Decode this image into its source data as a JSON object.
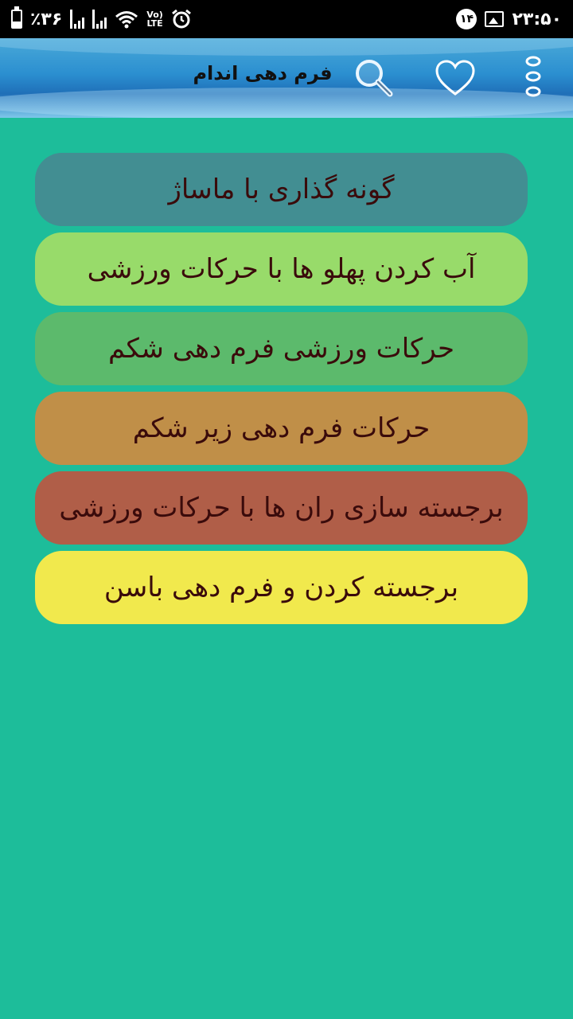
{
  "status_bar": {
    "battery_text": "٪۳۶",
    "battery_level": 0.36,
    "network_label_top": "Vo)",
    "network_label_bottom": "LTE",
    "notification_count": "۱۴",
    "time": "۲۳:۵۰"
  },
  "app_bar": {
    "title": "فرم دهی اندام",
    "icons": [
      "search-icon",
      "heart-icon",
      "more-options-icon"
    ]
  },
  "menu": {
    "items": [
      {
        "label": "گونه گذاری با ماساژ",
        "color": "#428e92"
      },
      {
        "label": "آب کردن پهلو ها با حرکات ورزشی",
        "color": "#98db6a"
      },
      {
        "label": "حرکات ورزشی فرم دهی شکم",
        "color": "#5cba6c"
      },
      {
        "label": "حرکات فرم دهی زیر شکم",
        "color": "#c08f48"
      },
      {
        "label": "برجسته سازی ران ها با حرکات ورزشی",
        "color": "#b05e48"
      },
      {
        "label": "برجسته کردن و فرم دهی باسن",
        "color": "#f1e94d"
      }
    ]
  },
  "colors": {
    "background": "#1dbd9a",
    "text": "#3a0b0b"
  }
}
